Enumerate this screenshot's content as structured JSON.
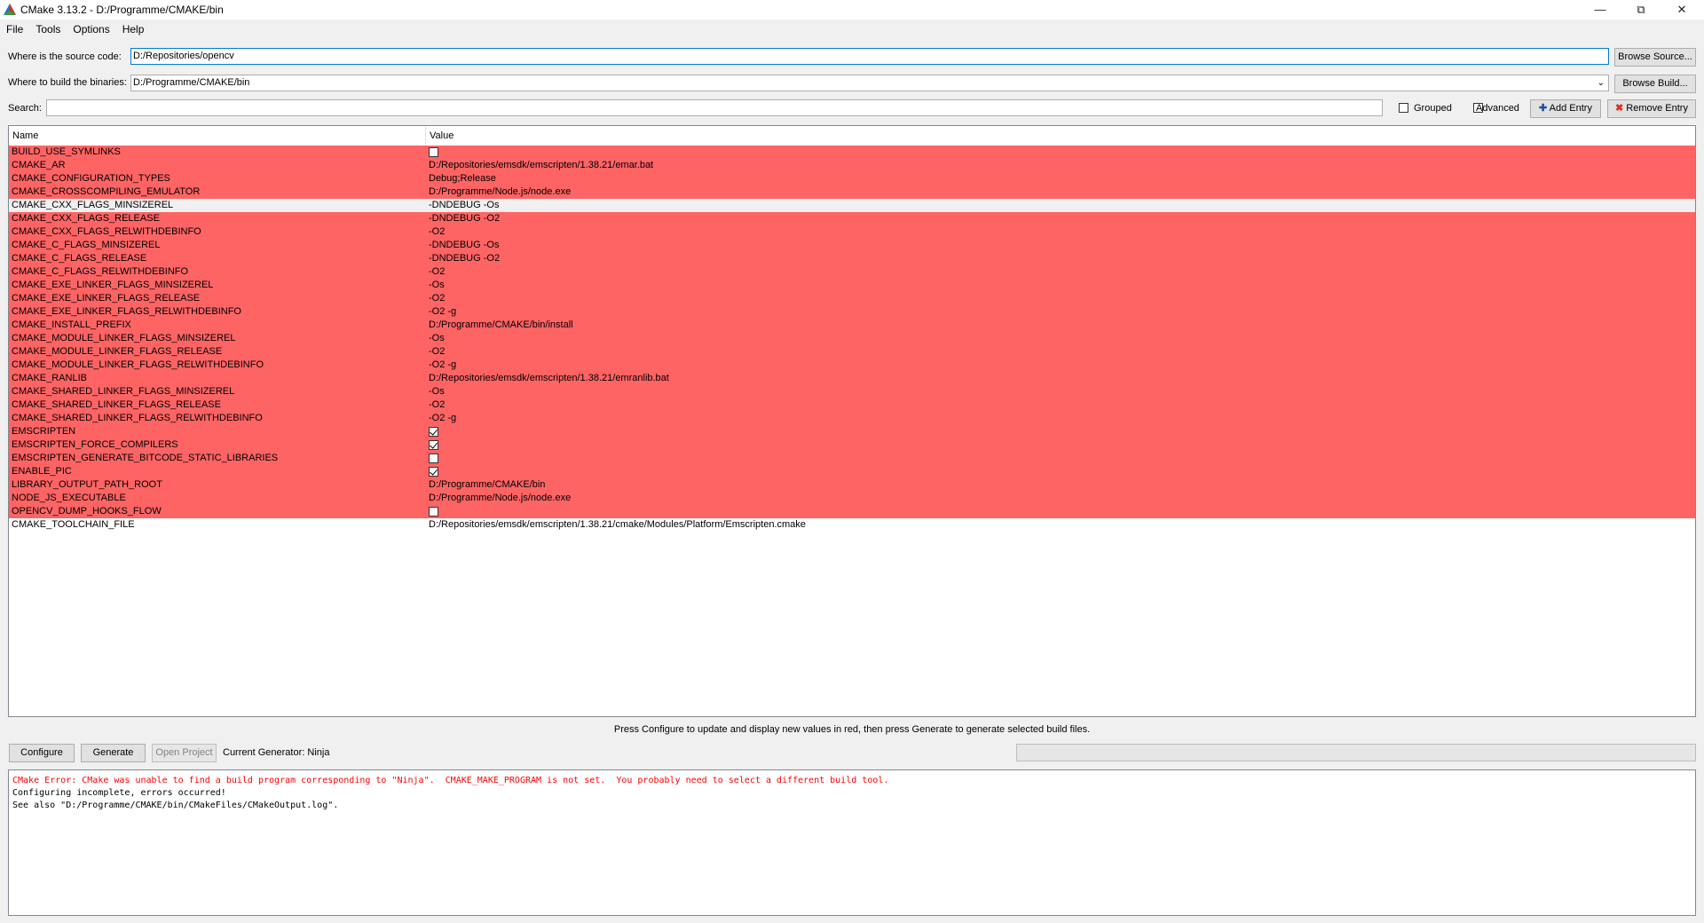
{
  "window": {
    "title": "CMake 3.13.2 - D:/Programme/CMAKE/bin",
    "minimize_glyph": "—",
    "maximize_glyph": "⧉",
    "close_glyph": "✕"
  },
  "menu": [
    "File",
    "Tools",
    "Options",
    "Help"
  ],
  "source": {
    "label": "Where is the source code:",
    "value": "D:/Repositories/opencv",
    "button": "Browse Source..."
  },
  "build": {
    "label": "Where to build the binaries:",
    "value": "D:/Programme/CMAKE/bin",
    "button": "Browse Build..."
  },
  "search": {
    "label": "Search:",
    "value": ""
  },
  "options": {
    "grouped": "Grouped",
    "advanced": "Advanced",
    "add_entry": "Add Entry",
    "remove_entry": "Remove Entry"
  },
  "table": {
    "columns": [
      "Name",
      "Value"
    ],
    "rows": [
      {
        "name": "BUILD_USE_SYMLINKS",
        "value": "",
        "type": "bool",
        "checked": false,
        "style": "red"
      },
      {
        "name": "CMAKE_AR",
        "value": "D:/Repositories/emsdk/emscripten/1.38.21/emar.bat",
        "type": "text",
        "style": "red"
      },
      {
        "name": "CMAKE_CONFIGURATION_TYPES",
        "value": "Debug;Release",
        "type": "text",
        "style": "red"
      },
      {
        "name": "CMAKE_CROSSCOMPILING_EMULATOR",
        "value": "D:/Programme/Node.js/node.exe",
        "type": "text",
        "style": "red"
      },
      {
        "name": "CMAKE_CXX_FLAGS_MINSIZEREL",
        "value": "-DNDEBUG -Os",
        "type": "text",
        "style": "sel"
      },
      {
        "name": "CMAKE_CXX_FLAGS_RELEASE",
        "value": "-DNDEBUG -O2",
        "type": "text",
        "style": "red"
      },
      {
        "name": "CMAKE_CXX_FLAGS_RELWITHDEBINFO",
        "value": "-O2",
        "type": "text",
        "style": "red"
      },
      {
        "name": "CMAKE_C_FLAGS_MINSIZEREL",
        "value": "-DNDEBUG -Os",
        "type": "text",
        "style": "red"
      },
      {
        "name": "CMAKE_C_FLAGS_RELEASE",
        "value": "-DNDEBUG -O2",
        "type": "text",
        "style": "red"
      },
      {
        "name": "CMAKE_C_FLAGS_RELWITHDEBINFO",
        "value": "-O2",
        "type": "text",
        "style": "red"
      },
      {
        "name": "CMAKE_EXE_LINKER_FLAGS_MINSIZEREL",
        "value": "-Os",
        "type": "text",
        "style": "red"
      },
      {
        "name": "CMAKE_EXE_LINKER_FLAGS_RELEASE",
        "value": "-O2",
        "type": "text",
        "style": "red"
      },
      {
        "name": "CMAKE_EXE_LINKER_FLAGS_RELWITHDEBINFO",
        "value": "-O2 -g",
        "type": "text",
        "style": "red"
      },
      {
        "name": "CMAKE_INSTALL_PREFIX",
        "value": "D:/Programme/CMAKE/bin/install",
        "type": "text",
        "style": "red"
      },
      {
        "name": "CMAKE_MODULE_LINKER_FLAGS_MINSIZEREL",
        "value": "-Os",
        "type": "text",
        "style": "red"
      },
      {
        "name": "CMAKE_MODULE_LINKER_FLAGS_RELEASE",
        "value": "-O2",
        "type": "text",
        "style": "red"
      },
      {
        "name": "CMAKE_MODULE_LINKER_FLAGS_RELWITHDEBINFO",
        "value": "-O2 -g",
        "type": "text",
        "style": "red"
      },
      {
        "name": "CMAKE_RANLIB",
        "value": "D:/Repositories/emsdk/emscripten/1.38.21/emranlib.bat",
        "type": "text",
        "style": "red"
      },
      {
        "name": "CMAKE_SHARED_LINKER_FLAGS_MINSIZEREL",
        "value": "-Os",
        "type": "text",
        "style": "red"
      },
      {
        "name": "CMAKE_SHARED_LINKER_FLAGS_RELEASE",
        "value": "-O2",
        "type": "text",
        "style": "red"
      },
      {
        "name": "CMAKE_SHARED_LINKER_FLAGS_RELWITHDEBINFO",
        "value": "-O2 -g",
        "type": "text",
        "style": "red"
      },
      {
        "name": "EMSCRIPTEN",
        "value": "",
        "type": "bool",
        "checked": true,
        "style": "red"
      },
      {
        "name": "EMSCRIPTEN_FORCE_COMPILERS",
        "value": "",
        "type": "bool",
        "checked": true,
        "style": "red"
      },
      {
        "name": "EMSCRIPTEN_GENERATE_BITCODE_STATIC_LIBRARIES",
        "value": "",
        "type": "bool",
        "checked": false,
        "style": "red"
      },
      {
        "name": "ENABLE_PIC",
        "value": "",
        "type": "bool",
        "checked": true,
        "style": "red"
      },
      {
        "name": "LIBRARY_OUTPUT_PATH_ROOT",
        "value": "D:/Programme/CMAKE/bin",
        "type": "text",
        "style": "red"
      },
      {
        "name": "NODE_JS_EXECUTABLE",
        "value": "D:/Programme/Node.js/node.exe",
        "type": "text",
        "style": "red"
      },
      {
        "name": "OPENCV_DUMP_HOOKS_FLOW",
        "value": "",
        "type": "bool",
        "checked": false,
        "style": "red"
      },
      {
        "name": "CMAKE_TOOLCHAIN_FILE",
        "value": "D:/Repositories/emsdk/emscripten/1.38.21/cmake/Modules/Platform/Emscripten.cmake",
        "type": "text",
        "style": "white"
      }
    ]
  },
  "hint": "Press Configure to update and display new values in red, then press Generate to generate selected build files.",
  "actions": {
    "configure": "Configure",
    "generate": "Generate",
    "open_project": "Open Project",
    "generator": "Current Generator: Ninja"
  },
  "progress": 0,
  "output": [
    {
      "text": "CMake Error: CMake was unable to find a build program corresponding to \"Ninja\".  CMAKE_MAKE_PROGRAM is not set.  You probably need to select a different build tool.",
      "type": "error"
    },
    {
      "text": "Configuring incomplete, errors occurred!",
      "type": "normal"
    },
    {
      "text": "See also \"D:/Programme/CMAKE/bin/CMakeFiles/CMakeOutput.log\".",
      "type": "normal"
    }
  ],
  "colors": {
    "changed_row": "#ff6464",
    "selected_row": "#f0f0f0",
    "error_text": "#ff0000",
    "focus_border": "#0078d7"
  }
}
